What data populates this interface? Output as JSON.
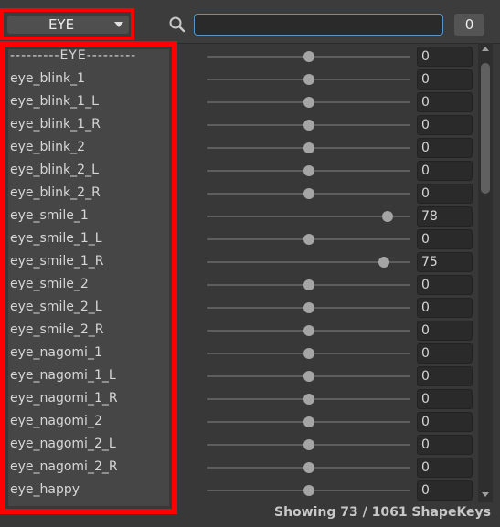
{
  "toolbar": {
    "category": "EYE",
    "search_value": "",
    "search_placeholder": "",
    "result_count": "0"
  },
  "shapekeys": [
    {
      "name": "---------EYE---------",
      "value": 0,
      "display": "0"
    },
    {
      "name": "eye_blink_1",
      "value": 0,
      "display": "0"
    },
    {
      "name": "eye_blink_1_L",
      "value": 0,
      "display": "0"
    },
    {
      "name": "eye_blink_1_R",
      "value": 0,
      "display": "0"
    },
    {
      "name": "eye_blink_2",
      "value": 0,
      "display": "0"
    },
    {
      "name": "eye_blink_2_L",
      "value": 0,
      "display": "0"
    },
    {
      "name": "eye_blink_2_R",
      "value": 0,
      "display": "0"
    },
    {
      "name": "eye_smile_1",
      "value": 78,
      "display": "78"
    },
    {
      "name": "eye_smile_1_L",
      "value": 0,
      "display": "0"
    },
    {
      "name": "eye_smile_1_R",
      "value": 75,
      "display": "75"
    },
    {
      "name": "eye_smile_2",
      "value": 0,
      "display": "0"
    },
    {
      "name": "eye_smile_2_L",
      "value": 0,
      "display": "0"
    },
    {
      "name": "eye_smile_2_R",
      "value": 0,
      "display": "0"
    },
    {
      "name": "eye_nagomi_1",
      "value": 0,
      "display": "0"
    },
    {
      "name": "eye_nagomi_1_L",
      "value": 0,
      "display": "0"
    },
    {
      "name": "eye_nagomi_1_R",
      "value": 0,
      "display": "0"
    },
    {
      "name": "eye_nagomi_2",
      "value": 0,
      "display": "0"
    },
    {
      "name": "eye_nagomi_2_L",
      "value": 0,
      "display": "0"
    },
    {
      "name": "eye_nagomi_2_R",
      "value": 0,
      "display": "0"
    },
    {
      "name": "eye_happy",
      "value": 0,
      "display": "0"
    }
  ],
  "slider_range": [
    -100,
    100
  ],
  "status": "Showing 73 / 1061 ShapeKeys",
  "colors": {
    "highlight": "#ff0000",
    "search_border": "#5a94c7"
  },
  "icons": {
    "search": "search-icon",
    "dropdown": "chevron-down-icon"
  }
}
